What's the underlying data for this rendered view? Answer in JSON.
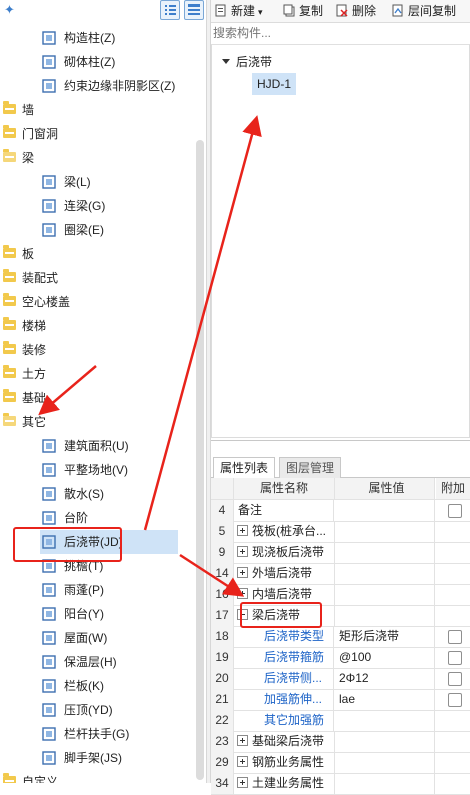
{
  "left_tree": {
    "items": [
      {
        "type": "leaf",
        "label": "构造柱(Z)",
        "icon": "column-icon"
      },
      {
        "type": "leaf",
        "label": "砌体柱(Z)",
        "icon": "masonry-column-icon"
      },
      {
        "type": "leaf",
        "label": "约束边缘非阴影区(Z)",
        "icon": "hatch-icon"
      },
      {
        "type": "cat",
        "label": "墙"
      },
      {
        "type": "cat",
        "label": "门窗洞"
      },
      {
        "type": "cat",
        "label": "梁",
        "open": true
      },
      {
        "type": "leaf",
        "label": "梁(L)",
        "icon": "beam-icon"
      },
      {
        "type": "leaf",
        "label": "连梁(G)",
        "icon": "link-beam-icon"
      },
      {
        "type": "leaf",
        "label": "圈梁(E)",
        "icon": "ring-beam-icon"
      },
      {
        "type": "cat",
        "label": "板"
      },
      {
        "type": "cat",
        "label": "装配式"
      },
      {
        "type": "cat",
        "label": "空心楼盖"
      },
      {
        "type": "cat",
        "label": "楼梯"
      },
      {
        "type": "cat",
        "label": "装修"
      },
      {
        "type": "cat",
        "label": "土方"
      },
      {
        "type": "cat",
        "label": "基础"
      },
      {
        "type": "cat",
        "label": "其它",
        "open": true
      },
      {
        "type": "leaf",
        "label": "建筑面积(U)",
        "icon": "area-icon"
      },
      {
        "type": "leaf",
        "label": "平整场地(V)",
        "icon": "grading-icon"
      },
      {
        "type": "leaf",
        "label": "散水(S)",
        "icon": "apron-icon"
      },
      {
        "type": "leaf",
        "label": "台阶",
        "icon": "step-icon"
      },
      {
        "type": "leaf",
        "label": "后浇带(JD)",
        "icon": "post-pour-icon",
        "selected": true
      },
      {
        "type": "leaf",
        "label": "挑檐(T)",
        "icon": "eave-icon"
      },
      {
        "type": "leaf",
        "label": "雨蓬(P)",
        "icon": "canopy-icon"
      },
      {
        "type": "leaf",
        "label": "阳台(Y)",
        "icon": "balcony-icon"
      },
      {
        "type": "leaf",
        "label": "屋面(W)",
        "icon": "roof-icon"
      },
      {
        "type": "leaf",
        "label": "保温层(H)",
        "icon": "insulation-icon"
      },
      {
        "type": "leaf",
        "label": "栏板(K)",
        "icon": "parapet-icon"
      },
      {
        "type": "leaf",
        "label": "压顶(YD)",
        "icon": "coping-icon"
      },
      {
        "type": "leaf",
        "label": "栏杆扶手(G)",
        "icon": "railing-icon"
      },
      {
        "type": "leaf",
        "label": "脚手架(JS)",
        "icon": "scaffold-icon"
      },
      {
        "type": "cat",
        "label": "自定义"
      }
    ]
  },
  "right_toolbar": {
    "new_label": "新建",
    "copy_label": "复制",
    "delete_label": "删除",
    "floor_copy_label": "层间复制"
  },
  "search": {
    "placeholder": "搜索构件..."
  },
  "component_list": {
    "group": "后浇带",
    "items": [
      "HJD-1"
    ]
  },
  "property_panel": {
    "tabs": [
      "属性列表",
      "图层管理"
    ],
    "columns": {
      "name": "属性名称",
      "value": "属性值",
      "add": "附加"
    },
    "rows": [
      {
        "num": "4",
        "name": "备注",
        "value": "",
        "check": true
      },
      {
        "num": "5",
        "name": "筏板(桩承台...",
        "value": "",
        "expander": "plus"
      },
      {
        "num": "9",
        "name": "现浇板后浇带",
        "value": "",
        "expander": "plus"
      },
      {
        "num": "14",
        "name": "外墙后浇带",
        "value": "",
        "expander": "plus"
      },
      {
        "num": "16",
        "name": "内墙后浇带",
        "value": "",
        "expander": "plus"
      },
      {
        "num": "17",
        "name": "梁后浇带",
        "value": "",
        "expander": "minus"
      },
      {
        "num": "18",
        "name": "后浇带类型",
        "value": "矩形后浇带",
        "blue": true,
        "check": true
      },
      {
        "num": "19",
        "name": "后浇带箍筋",
        "value": "@100",
        "blue": true,
        "check": true
      },
      {
        "num": "20",
        "name": "后浇带侧...",
        "value": "2Φ12",
        "blue": true,
        "check": true
      },
      {
        "num": "21",
        "name": "加强筋伸...",
        "value": "lae",
        "blue": true,
        "check": true
      },
      {
        "num": "22",
        "name": "其它加强筋",
        "value": "",
        "blue": true
      },
      {
        "num": "23",
        "name": "基础梁后浇带",
        "value": "",
        "expander": "plus"
      },
      {
        "num": "29",
        "name": "钢筋业务属性",
        "value": "",
        "expander": "plus"
      },
      {
        "num": "34",
        "name": "土建业务属性",
        "value": "",
        "expander": "plus"
      }
    ]
  },
  "colors": {
    "selection": "#cfe3f7",
    "annotation": "#e8231b",
    "link_blue": "#1d63c7"
  }
}
